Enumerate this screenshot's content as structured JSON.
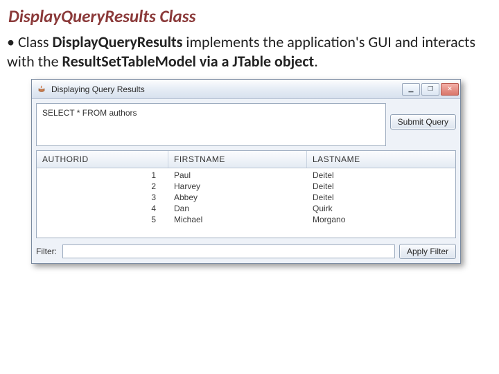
{
  "slide": {
    "title": "DisplayQueryResults Class",
    "bullet_prefix": "Class ",
    "bullet_bold1": "DisplayQueryResults",
    "bullet_mid": " implements the application's GUI and interacts with the ",
    "bullet_bold2": "ResultSetTableModel via a JTable object",
    "bullet_end": "."
  },
  "window": {
    "title": "Displaying Query Results",
    "controls": {
      "min": "▁",
      "max": "❐",
      "close": "✕"
    },
    "query_text": "SELECT * FROM authors",
    "submit_label": "Submit Query",
    "filter_label": "Filter:",
    "filter_value": "",
    "apply_filter_label": "Apply Filter"
  },
  "table": {
    "columns": {
      "c0": "AUTHORID",
      "c1": "FIRSTNAME",
      "c2": "LASTNAME"
    },
    "rows": [
      {
        "id": "1",
        "first": "Paul",
        "last": "Deitel"
      },
      {
        "id": "2",
        "first": "Harvey",
        "last": "Deitel"
      },
      {
        "id": "3",
        "first": "Abbey",
        "last": "Deitel"
      },
      {
        "id": "4",
        "first": "Dan",
        "last": "Quirk"
      },
      {
        "id": "5",
        "first": "Michael",
        "last": "Morgano"
      }
    ]
  }
}
